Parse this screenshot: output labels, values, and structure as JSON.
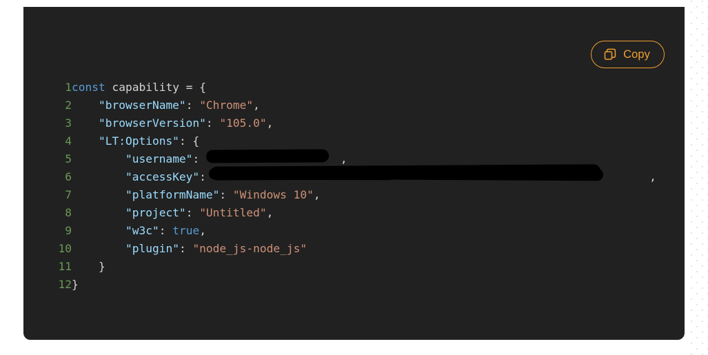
{
  "panel": {
    "background_color": "#212121",
    "page_background_color": "#ffffff"
  },
  "toolbar": {
    "copy_label": "Copy",
    "copy_icon": "copy-icon",
    "accent_color": "#f0a030"
  },
  "editor": {
    "language": "javascript",
    "line_number_color": "#6a9955",
    "total_lines": 12,
    "lines": [
      {
        "number": "1",
        "tokens": [
          {
            "t": "const",
            "c": "kw"
          },
          {
            "t": " ",
            "c": "plain"
          },
          {
            "t": "capability",
            "c": "plain"
          },
          {
            "t": " = {",
            "c": "punc"
          }
        ]
      },
      {
        "number": "2",
        "tokens": [
          {
            "t": "    ",
            "c": "plain"
          },
          {
            "t": "\"browserName\"",
            "c": "key"
          },
          {
            "t": ": ",
            "c": "punc"
          },
          {
            "t": "\"Chrome\"",
            "c": "str"
          },
          {
            "t": ",",
            "c": "punc"
          }
        ]
      },
      {
        "number": "3",
        "tokens": [
          {
            "t": "    ",
            "c": "plain"
          },
          {
            "t": "\"browserVersion\"",
            "c": "key"
          },
          {
            "t": ": ",
            "c": "punc"
          },
          {
            "t": "\"105.0\"",
            "c": "str"
          },
          {
            "t": ",",
            "c": "punc"
          }
        ]
      },
      {
        "number": "4",
        "tokens": [
          {
            "t": "    ",
            "c": "plain"
          },
          {
            "t": "\"LT:Options\"",
            "c": "key"
          },
          {
            "t": ": {",
            "c": "punc"
          }
        ]
      },
      {
        "number": "5",
        "tokens": [
          {
            "t": "        ",
            "c": "plain"
          },
          {
            "t": "\"username\"",
            "c": "key"
          },
          {
            "t": ": ",
            "c": "punc"
          }
        ],
        "redacted": "username",
        "trailing": ","
      },
      {
        "number": "6",
        "tokens": [
          {
            "t": "        ",
            "c": "plain"
          },
          {
            "t": "\"accessKey\"",
            "c": "key"
          },
          {
            "t": ": ",
            "c": "punc"
          }
        ],
        "redacted": "accessKey",
        "trailing": ","
      },
      {
        "number": "7",
        "tokens": [
          {
            "t": "        ",
            "c": "plain"
          },
          {
            "t": "\"platformName\"",
            "c": "key"
          },
          {
            "t": ": ",
            "c": "punc"
          },
          {
            "t": "\"Windows 10\"",
            "c": "str"
          },
          {
            "t": ",",
            "c": "punc"
          }
        ]
      },
      {
        "number": "8",
        "tokens": [
          {
            "t": "        ",
            "c": "plain"
          },
          {
            "t": "\"project\"",
            "c": "key"
          },
          {
            "t": ": ",
            "c": "punc"
          },
          {
            "t": "\"Untitled\"",
            "c": "str"
          },
          {
            "t": ",",
            "c": "punc"
          }
        ]
      },
      {
        "number": "9",
        "tokens": [
          {
            "t": "        ",
            "c": "plain"
          },
          {
            "t": "\"w3c\"",
            "c": "key"
          },
          {
            "t": ": ",
            "c": "punc"
          },
          {
            "t": "true",
            "c": "bool"
          },
          {
            "t": ",",
            "c": "punc"
          }
        ]
      },
      {
        "number": "10",
        "tokens": [
          {
            "t": "        ",
            "c": "plain"
          },
          {
            "t": "\"plugin\"",
            "c": "key"
          },
          {
            "t": ": ",
            "c": "punc"
          },
          {
            "t": "\"node_js-node_js\"",
            "c": "str"
          }
        ]
      },
      {
        "number": "11",
        "tokens": [
          {
            "t": "    }",
            "c": "punc"
          }
        ]
      },
      {
        "number": "12",
        "tokens": [
          {
            "t": "}",
            "c": "punc"
          }
        ]
      }
    ]
  }
}
